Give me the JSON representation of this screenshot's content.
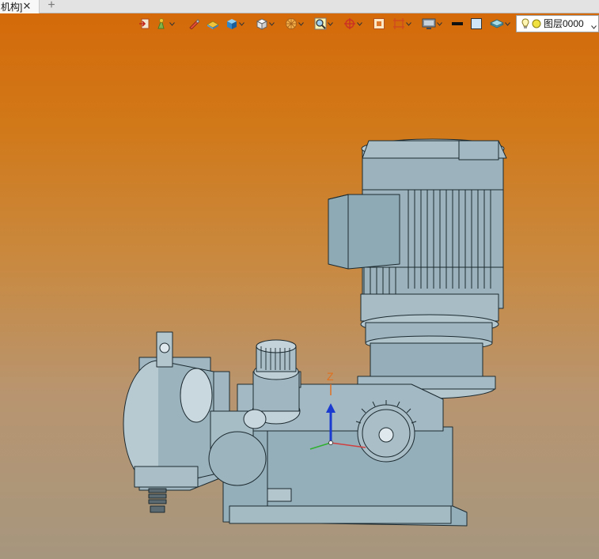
{
  "tab": {
    "label": "机构]",
    "close": "✕",
    "add": "+"
  },
  "toolbar": {
    "layer": {
      "name": "图层0000"
    },
    "tools": [
      "exit-icon",
      "measure-icon",
      "pen-icon",
      "render-icon",
      "solid-view-icon",
      "view-cube-icon",
      "section-wheel-icon",
      "zoom-icon",
      "orient-icon",
      "fit-icon",
      "frame-icon",
      "display-icon",
      "line-color-icon",
      "fill-color-icon",
      "layer-stack-icon"
    ]
  },
  "viewport": {
    "axis": {
      "z_label": "Z"
    },
    "background_top": "#d46a0a",
    "background_bottom": "#a6967e",
    "model_color": "#9fb7c1"
  }
}
